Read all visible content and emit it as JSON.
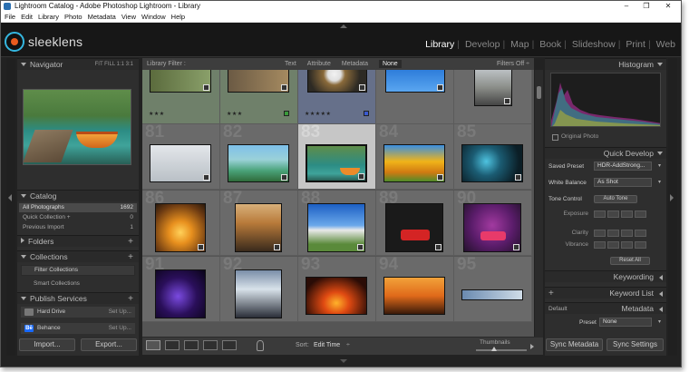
{
  "window": {
    "title": "Lightroom Catalog - Adobe Photoshop Lightroom - Library",
    "minimize_glyph": "–",
    "maximize_glyph": "❐",
    "close_glyph": "✕"
  },
  "menu": [
    "File",
    "Edit",
    "Library",
    "Photo",
    "Metadata",
    "View",
    "Window",
    "Help"
  ],
  "identity": {
    "brand": "sleeklens",
    "modules": [
      "Library",
      "Develop",
      "Map",
      "Book",
      "Slideshow",
      "Print",
      "Web"
    ],
    "active_module": "Library"
  },
  "left_panel": {
    "navigator": {
      "title": "Navigator",
      "zoom": [
        "FIT",
        "FILL",
        "1:1",
        "3:1"
      ]
    },
    "catalog": {
      "title": "Catalog",
      "items": [
        {
          "label": "All Photographs",
          "count": "1692"
        },
        {
          "label": "Quick Collection +",
          "count": "0"
        },
        {
          "label": "Previous Import",
          "count": "1"
        }
      ]
    },
    "folders": {
      "title": "Folders"
    },
    "collections": {
      "title": "Collections",
      "filter": "Filter Collections",
      "smart": "Smart Collections"
    },
    "publish": {
      "title": "Publish Services",
      "items": [
        {
          "label": "Hard Drive",
          "action": "Set Up..."
        },
        {
          "label": "Behance",
          "action": "Set Up..."
        }
      ]
    },
    "import_label": "Import...",
    "export_label": "Export..."
  },
  "filter_bar": {
    "title": "Library Filter :",
    "options": [
      "Text",
      "Attribute",
      "Metadata",
      "None"
    ],
    "active": "None",
    "status": "Filters Off ÷"
  },
  "grid": {
    "rows": [
      {
        "numbers": [
          "",
          "",
          "",
          "",
          ""
        ]
      },
      {
        "numbers": [
          "81",
          "82",
          "83",
          "84",
          "85"
        ]
      },
      {
        "numbers": [
          "86",
          "87",
          "88",
          "89",
          "90"
        ]
      },
      {
        "numbers": [
          "91",
          "92",
          "93",
          "94",
          "95"
        ]
      }
    ],
    "row1_stars": [
      "★★★",
      "★★★",
      "★★★★★",
      "",
      ""
    ]
  },
  "toolbar": {
    "sort_label": "Sort:",
    "sort_value": "Edit Time",
    "sort_chevron": "÷",
    "thumbnails_label": "Thumbnails",
    "thumbnail_size": 0.35,
    "view_modes": [
      "grid",
      "loupe",
      "compare",
      "survey",
      "people"
    ]
  },
  "right_panel": {
    "histogram": {
      "title": "Histogram",
      "original_photo": "Original Photo"
    },
    "quick_develop": {
      "title": "Quick Develop",
      "saved_preset_label": "Saved Preset",
      "saved_preset_value": "HDR-AddStrong...",
      "white_balance_label": "White Balance",
      "white_balance_value": "As Shot",
      "tone_control_label": "Tone Control",
      "auto_tone": "Auto Tone",
      "sliders": [
        "Exposure",
        "Clarity",
        "Vibrance"
      ],
      "reset_all": "Reset All"
    },
    "keywording": {
      "title": "Keywording"
    },
    "keyword_list": {
      "title": "Keyword List"
    },
    "metadata": {
      "title": "Metadata",
      "default_label": "Default",
      "preset_label": "Preset",
      "preset_value": "None"
    },
    "sync_metadata": "Sync Metadata",
    "sync_settings": "Sync Settings"
  },
  "colors": {
    "accent": "#35b7e0",
    "selected_cell": "#c6c6c6",
    "panel": "#2e2e2e"
  }
}
